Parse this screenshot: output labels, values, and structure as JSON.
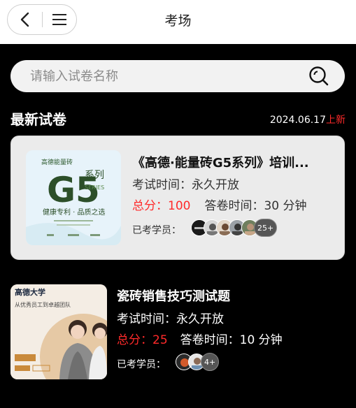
{
  "nav": {
    "title": "考场",
    "back_icon": "back-arrow-icon",
    "menu_icon": "hamburger-menu-icon"
  },
  "search": {
    "placeholder": "请输入试卷名称",
    "icon": "search-icon"
  },
  "section": {
    "title": "最新试卷",
    "date": "2024.06.17",
    "new_label": "上新"
  },
  "exams": [
    {
      "title": "《高德·能量砖G5系列》培训...",
      "time_label": "考试时间：",
      "time_value": "永久开放",
      "score_label": "总分：",
      "score_value": "100",
      "duration_label": "答卷时间：",
      "duration_value": "30 分钟",
      "participants_label": "已考学员：",
      "more_count": "25+",
      "cover": {
        "brand": "高德能量砖",
        "series_big": "G5",
        "series_small": "系列",
        "series_en": "SERIES",
        "slogan": "健康专利 · 品质之选"
      }
    },
    {
      "title": "瓷砖销售技巧测试题",
      "time_label": "考试时间：",
      "time_value": "永久开放",
      "score_label": "总分：",
      "score_value": "25",
      "duration_label": "答卷时间：",
      "duration_value": "10 分钟",
      "participants_label": "已考学员：",
      "more_count": "4+",
      "cover": {
        "brand": "高德大学",
        "subtitle": "从优秀员工到卓越团队"
      }
    }
  ],
  "colors": {
    "accent_red": "#ff2a2a",
    "background": "#000000",
    "card_bg": "#ebebeb"
  }
}
